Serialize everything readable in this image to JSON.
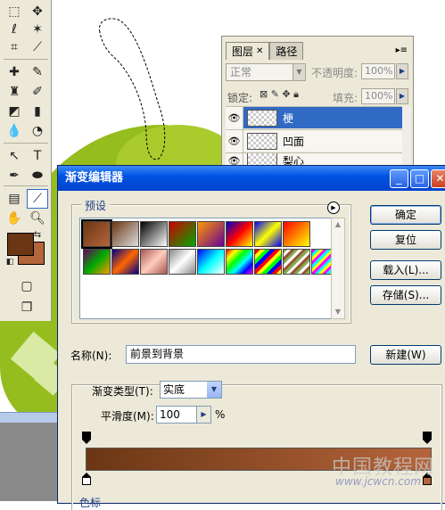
{
  "layers_panel": {
    "tabs": [
      "图层",
      "路径"
    ],
    "blend_mode": "正常",
    "opacity_label": "不透明度:",
    "opacity_value": "100%",
    "lock_label": "锁定:",
    "fill_label": "填充:",
    "fill_value": "100%",
    "layers": [
      {
        "name": "梗",
        "selected": true
      },
      {
        "name": "凹面",
        "selected": false
      },
      {
        "name": "梨心",
        "selected": false
      }
    ]
  },
  "dialog": {
    "title": "渐变编辑器",
    "presets_label": "预设",
    "buttons": {
      "ok": "确定",
      "reset": "复位",
      "load": "载入(L)...",
      "save": "存储(S)..."
    },
    "name_label": "名称(N):",
    "name_value": "前景到背景",
    "new_button": "新建(W)",
    "gradient_type_label": "渐变类型(T):",
    "gradient_type_value": "实底",
    "smoothness_label": "平滑度(M):",
    "smoothness_value": "100",
    "smoothness_unit": "%",
    "stops_section": "色标"
  },
  "colors": {
    "foreground": "#6b3614",
    "background": "#b5653b",
    "canvas_green": "#95bd1e",
    "titlebar_blue": "#0054e3"
  },
  "watermark": {
    "cn": "中国教程网",
    "url": "www.jcwcn.com"
  }
}
